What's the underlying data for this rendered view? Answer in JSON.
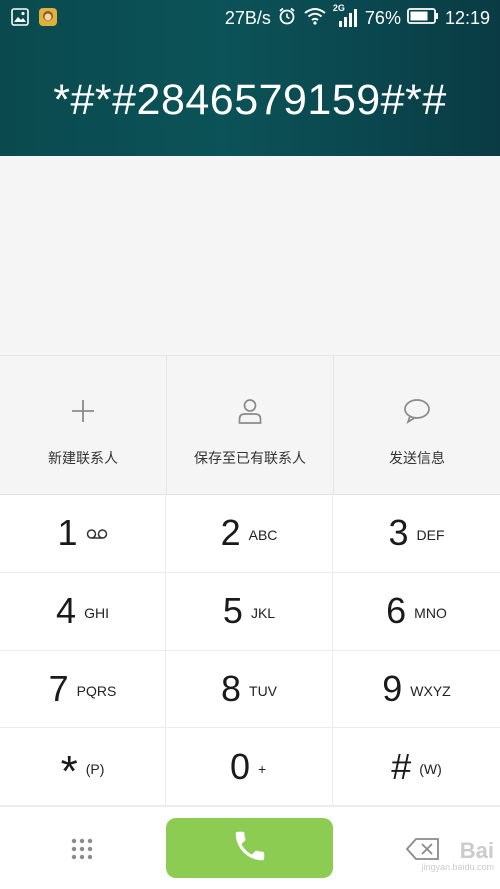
{
  "status_bar": {
    "net_speed": "27B/s",
    "network_type": "2G",
    "battery": "76%",
    "time": "12:19",
    "icons": [
      "gallery-icon",
      "app-avatar-icon",
      "alarm-icon",
      "wifi-icon",
      "signal-icon",
      "battery-icon"
    ]
  },
  "dialer": {
    "number": "*#*#2846579159#*#"
  },
  "actions": [
    {
      "label": "新建联系人",
      "icon": "plus-icon"
    },
    {
      "label": "保存至已有联系人",
      "icon": "person-icon"
    },
    {
      "label": "发送信息",
      "icon": "message-icon"
    }
  ],
  "keys": [
    {
      "digit": "1",
      "letters": ""
    },
    {
      "digit": "2",
      "letters": "ABC"
    },
    {
      "digit": "3",
      "letters": "DEF"
    },
    {
      "digit": "4",
      "letters": "GHI"
    },
    {
      "digit": "5",
      "letters": "JKL"
    },
    {
      "digit": "6",
      "letters": "MNO"
    },
    {
      "digit": "7",
      "letters": "PQRS"
    },
    {
      "digit": "8",
      "letters": "TUV"
    },
    {
      "digit": "9",
      "letters": "WXYZ"
    },
    {
      "digit": "*",
      "letters": "(P)"
    },
    {
      "digit": "0",
      "letters": "+"
    },
    {
      "digit": "#",
      "letters": "(W)"
    }
  ],
  "bottom_bar": {
    "icons": [
      "dialpad-menu-icon",
      "phone-icon",
      "backspace-icon"
    ],
    "call_color": "#8ccc52"
  },
  "watermark": {
    "brand": "Bai",
    "sub": "jingyan.baidu.com"
  },
  "colors": {
    "header": "#0b5358",
    "accent_green": "#8ccc52"
  }
}
